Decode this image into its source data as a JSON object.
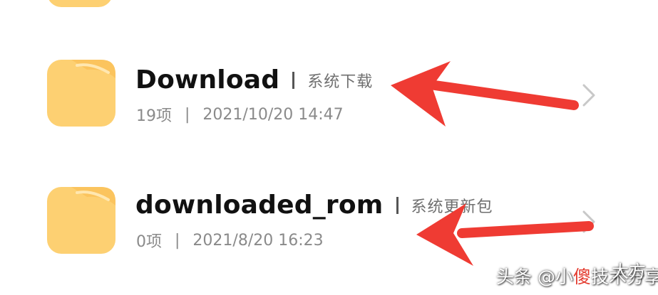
{
  "colors": {
    "folder": "#fdd072",
    "folder_tab": "#fbc45e",
    "arrow": "#ef3b33",
    "chevron": "#c8c8c8"
  },
  "files": [
    {
      "name": "Download",
      "description": "系统下载",
      "item_count": "19项",
      "date": "2021/10/20 14:47",
      "icon": "folder-icon"
    },
    {
      "name": "downloaded_rom",
      "description": "系统更新包",
      "item_count": "0项",
      "date": "2021/8/20 16:23",
      "icon": "folder-icon"
    }
  ],
  "separator": "|",
  "watermark": {
    "prefix": "头条 @小",
    "highlight": "傻",
    "suffix": "技术分享",
    "overlay": "大方"
  }
}
